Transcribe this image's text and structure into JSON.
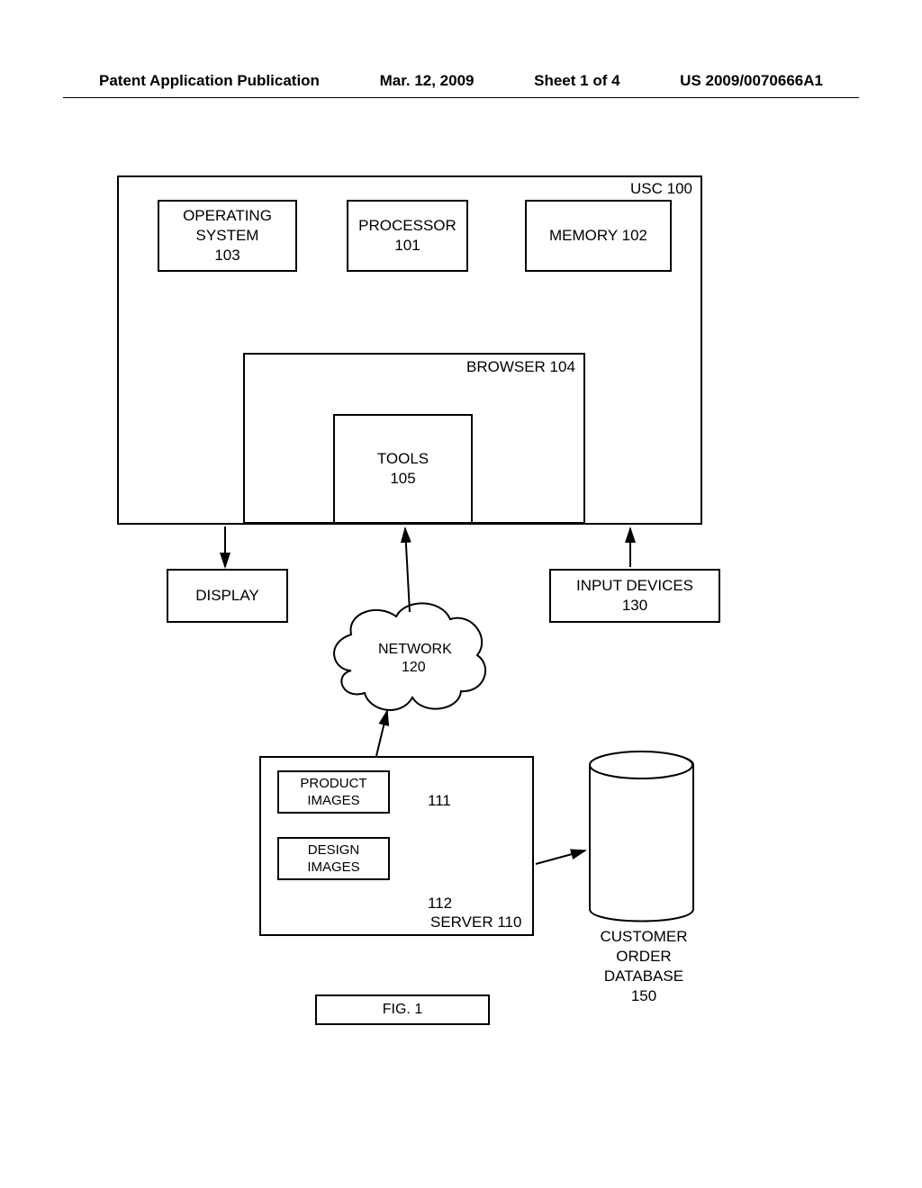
{
  "header": {
    "pubtype": "Patent Application Publication",
    "date": "Mar. 12, 2009",
    "sheet": "Sheet 1 of 4",
    "pubno": "US 2009/0070666A1"
  },
  "usc_label": "USC 100",
  "os": {
    "l1": "OPERATING",
    "l2": "SYSTEM",
    "l3": "103"
  },
  "processor": {
    "l1": "PROCESSOR",
    "l2": "101"
  },
  "memory": "MEMORY 102",
  "browser": "BROWSER 104",
  "tools": {
    "l1": "TOOLS",
    "l2": "105"
  },
  "display": "DISPLAY",
  "input": {
    "l1": "INPUT DEVICES",
    "l2": "130"
  },
  "network": {
    "l1": "NETWORK",
    "l2": "120"
  },
  "server": {
    "label": "SERVER 110",
    "product": {
      "l1": "PRODUCT",
      "l2": "IMAGES",
      "ref": "111"
    },
    "design": {
      "l1": "DESIGN",
      "l2": "IMAGES",
      "ref": "112"
    }
  },
  "db": {
    "l1": "CUSTOMER ORDER",
    "l2": "DATABASE",
    "l3": "150"
  },
  "figlabel": "FIG. 1"
}
